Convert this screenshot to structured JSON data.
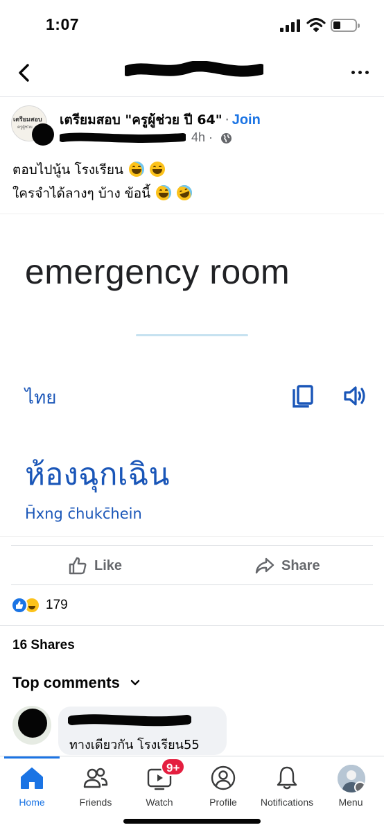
{
  "status_bar": {
    "time": "1:07",
    "signal_icon": "signal-bars-icon",
    "wifi_icon": "wifi-icon",
    "battery_icon": "battery-icon",
    "battery_level": 0.2
  },
  "nav": {
    "back_icon": "chevron-left-icon",
    "title_redacted": true,
    "more_icon": "more-dots-icon"
  },
  "post": {
    "group_avatar_text": "เตรียมสอบ",
    "group_avatar_subtext": "ครูผู้ช่วย",
    "group_name": "เตรียมสอบ \"ครูผู้ช่วย ปี 64\"",
    "separator": "·",
    "join_label": "Join",
    "time": "4h ·",
    "privacy_icon": "globe-icon",
    "caption_line1": "ตอบไปนู้น โรงเรียน",
    "caption_line2": "ใครจำได้ลางๆ บ้าง ข้อนี้"
  },
  "translate": {
    "source_text": "emergency room",
    "target_language": "ไทย",
    "copy_icon": "copy-icon",
    "speaker_icon": "speaker-icon",
    "translated_text": "ห้องฉุกเฉิน",
    "transliteration": "H̄xng c̄hukc̄hein"
  },
  "actions": {
    "like_label": "Like",
    "share_label": "Share",
    "reaction_count": "179",
    "shares": "16 Shares",
    "top_comments": "Top comments"
  },
  "comment": {
    "author_redacted": true,
    "text": "ทางเดียวกัน โรงเรียน55"
  },
  "tabs": [
    {
      "label": "Home",
      "icon": "home-icon",
      "active": true
    },
    {
      "label": "Friends",
      "icon": "friends-icon"
    },
    {
      "label": "Watch",
      "icon": "watch-icon",
      "badge": "9+"
    },
    {
      "label": "Profile",
      "icon": "profile-icon"
    },
    {
      "label": "Notifications",
      "icon": "bell-icon"
    },
    {
      "label": "Menu",
      "icon": "menu-avatar-icon"
    }
  ],
  "colors": {
    "accent": "#1b74e4",
    "translate_blue": "#1a56b8",
    "badge_red": "#e41e3f",
    "secondary_text": "#65676b"
  }
}
